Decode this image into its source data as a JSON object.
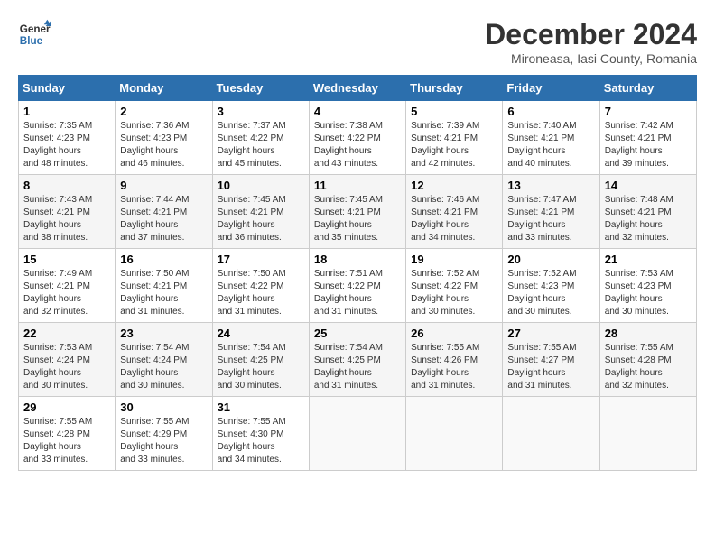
{
  "logo": {
    "line1": "General",
    "line2": "Blue"
  },
  "title": "December 2024",
  "subtitle": "Mironeasa, Iasi County, Romania",
  "days_header": [
    "Sunday",
    "Monday",
    "Tuesday",
    "Wednesday",
    "Thursday",
    "Friday",
    "Saturday"
  ],
  "weeks": [
    [
      {
        "day": "1",
        "sunrise": "7:35 AM",
        "sunset": "4:23 PM",
        "daylight": "8 hours and 48 minutes."
      },
      {
        "day": "2",
        "sunrise": "7:36 AM",
        "sunset": "4:23 PM",
        "daylight": "8 hours and 46 minutes."
      },
      {
        "day": "3",
        "sunrise": "7:37 AM",
        "sunset": "4:22 PM",
        "daylight": "8 hours and 45 minutes."
      },
      {
        "day": "4",
        "sunrise": "7:38 AM",
        "sunset": "4:22 PM",
        "daylight": "8 hours and 43 minutes."
      },
      {
        "day": "5",
        "sunrise": "7:39 AM",
        "sunset": "4:21 PM",
        "daylight": "8 hours and 42 minutes."
      },
      {
        "day": "6",
        "sunrise": "7:40 AM",
        "sunset": "4:21 PM",
        "daylight": "8 hours and 40 minutes."
      },
      {
        "day": "7",
        "sunrise": "7:42 AM",
        "sunset": "4:21 PM",
        "daylight": "8 hours and 39 minutes."
      }
    ],
    [
      {
        "day": "8",
        "sunrise": "7:43 AM",
        "sunset": "4:21 PM",
        "daylight": "8 hours and 38 minutes."
      },
      {
        "day": "9",
        "sunrise": "7:44 AM",
        "sunset": "4:21 PM",
        "daylight": "8 hours and 37 minutes."
      },
      {
        "day": "10",
        "sunrise": "7:45 AM",
        "sunset": "4:21 PM",
        "daylight": "8 hours and 36 minutes."
      },
      {
        "day": "11",
        "sunrise": "7:45 AM",
        "sunset": "4:21 PM",
        "daylight": "8 hours and 35 minutes."
      },
      {
        "day": "12",
        "sunrise": "7:46 AM",
        "sunset": "4:21 PM",
        "daylight": "8 hours and 34 minutes."
      },
      {
        "day": "13",
        "sunrise": "7:47 AM",
        "sunset": "4:21 PM",
        "daylight": "8 hours and 33 minutes."
      },
      {
        "day": "14",
        "sunrise": "7:48 AM",
        "sunset": "4:21 PM",
        "daylight": "8 hours and 32 minutes."
      }
    ],
    [
      {
        "day": "15",
        "sunrise": "7:49 AM",
        "sunset": "4:21 PM",
        "daylight": "8 hours and 32 minutes."
      },
      {
        "day": "16",
        "sunrise": "7:50 AM",
        "sunset": "4:21 PM",
        "daylight": "8 hours and 31 minutes."
      },
      {
        "day": "17",
        "sunrise": "7:50 AM",
        "sunset": "4:22 PM",
        "daylight": "8 hours and 31 minutes."
      },
      {
        "day": "18",
        "sunrise": "7:51 AM",
        "sunset": "4:22 PM",
        "daylight": "8 hours and 31 minutes."
      },
      {
        "day": "19",
        "sunrise": "7:52 AM",
        "sunset": "4:22 PM",
        "daylight": "8 hours and 30 minutes."
      },
      {
        "day": "20",
        "sunrise": "7:52 AM",
        "sunset": "4:23 PM",
        "daylight": "8 hours and 30 minutes."
      },
      {
        "day": "21",
        "sunrise": "7:53 AM",
        "sunset": "4:23 PM",
        "daylight": "8 hours and 30 minutes."
      }
    ],
    [
      {
        "day": "22",
        "sunrise": "7:53 AM",
        "sunset": "4:24 PM",
        "daylight": "8 hours and 30 minutes."
      },
      {
        "day": "23",
        "sunrise": "7:54 AM",
        "sunset": "4:24 PM",
        "daylight": "8 hours and 30 minutes."
      },
      {
        "day": "24",
        "sunrise": "7:54 AM",
        "sunset": "4:25 PM",
        "daylight": "8 hours and 30 minutes."
      },
      {
        "day": "25",
        "sunrise": "7:54 AM",
        "sunset": "4:25 PM",
        "daylight": "8 hours and 31 minutes."
      },
      {
        "day": "26",
        "sunrise": "7:55 AM",
        "sunset": "4:26 PM",
        "daylight": "8 hours and 31 minutes."
      },
      {
        "day": "27",
        "sunrise": "7:55 AM",
        "sunset": "4:27 PM",
        "daylight": "8 hours and 31 minutes."
      },
      {
        "day": "28",
        "sunrise": "7:55 AM",
        "sunset": "4:28 PM",
        "daylight": "8 hours and 32 minutes."
      }
    ],
    [
      {
        "day": "29",
        "sunrise": "7:55 AM",
        "sunset": "4:28 PM",
        "daylight": "8 hours and 33 minutes."
      },
      {
        "day": "30",
        "sunrise": "7:55 AM",
        "sunset": "4:29 PM",
        "daylight": "8 hours and 33 minutes."
      },
      {
        "day": "31",
        "sunrise": "7:55 AM",
        "sunset": "4:30 PM",
        "daylight": "8 hours and 34 minutes."
      },
      null,
      null,
      null,
      null
    ]
  ],
  "label_sunrise": "Sunrise:",
  "label_sunset": "Sunset:",
  "label_daylight": "Daylight hours"
}
